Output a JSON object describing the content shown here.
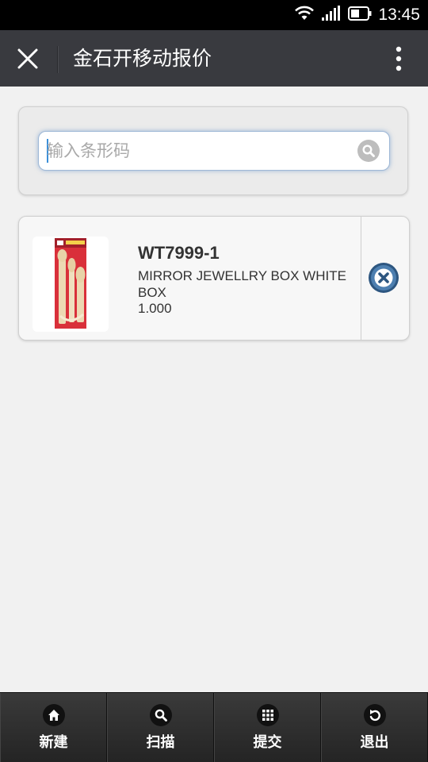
{
  "status_bar": {
    "time": "13:45",
    "icons": [
      "wifi-icon",
      "signal-icon",
      "battery-icon"
    ]
  },
  "header": {
    "title": "金石开移动报价",
    "close_icon": "close-icon",
    "menu_icon": "more-vertical-icon"
  },
  "search": {
    "placeholder": "输入条形码",
    "value": "",
    "icon": "search-icon"
  },
  "products": [
    {
      "code": "WT7999-1",
      "name": "MIRROR JEWELLRY BOX WHITE BOX",
      "quantity": "1.000",
      "remove_icon": "remove-circle-icon"
    }
  ],
  "toolbar": {
    "items": [
      {
        "label": "新建",
        "icon": "home-icon"
      },
      {
        "label": "扫描",
        "icon": "search-icon"
      },
      {
        "label": "提交",
        "icon": "grid-icon"
      },
      {
        "label": "退出",
        "icon": "undo-icon"
      }
    ]
  },
  "colors": {
    "status_bar": "#000000",
    "title_bar": "#393a3f",
    "page_background": "#f1f1f1",
    "toolbar": "#2b2b2b",
    "remove_button": "#3e6e9c"
  }
}
